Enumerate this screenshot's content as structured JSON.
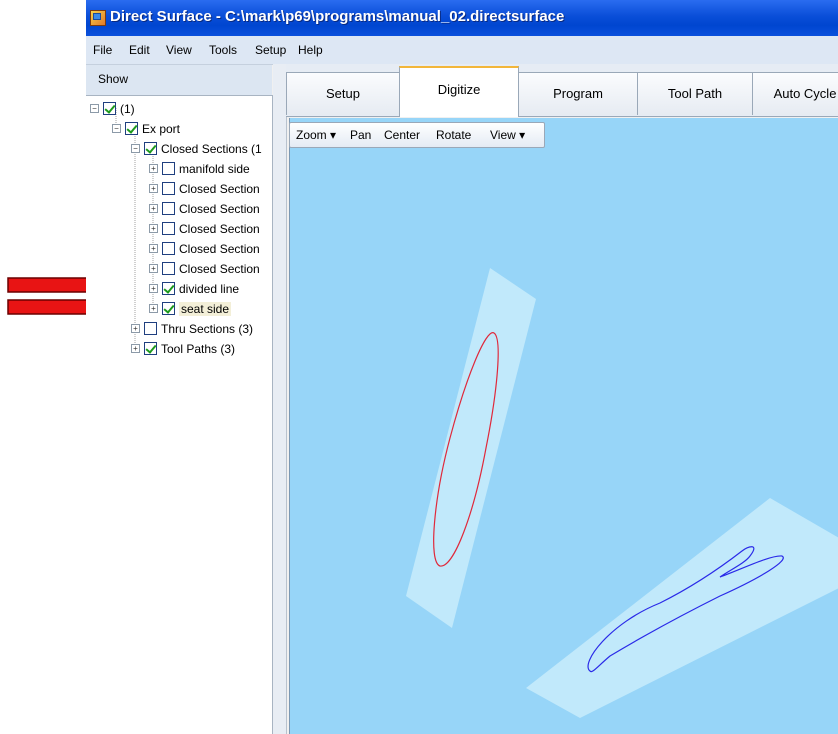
{
  "window": {
    "title": "Direct Surface - C:\\mark\\p69\\programs\\manual_02.directsurface"
  },
  "menu": {
    "items": [
      "File",
      "Edit",
      "View",
      "Tools",
      "Setup",
      "Help"
    ]
  },
  "sidebar": {
    "header": "Show",
    "tree": [
      {
        "label": "(1)",
        "checked": true
      },
      {
        "label": "Ex port",
        "checked": true
      },
      {
        "label": "Closed Sections (1",
        "checked": true
      },
      {
        "label": "manifold side",
        "checked": false
      },
      {
        "label": "Closed Section",
        "checked": false
      },
      {
        "label": "Closed Section",
        "checked": false
      },
      {
        "label": "Closed Section",
        "checked": false
      },
      {
        "label": "Closed Section",
        "checked": false
      },
      {
        "label": "Closed Section",
        "checked": false
      },
      {
        "label": "divided line",
        "checked": true
      },
      {
        "label": "seat side",
        "checked": true
      },
      {
        "label": "Thru Sections (3)",
        "checked": false
      },
      {
        "label": "Tool Paths (3)",
        "checked": true
      }
    ]
  },
  "tabs": [
    "Setup",
    "Digitize",
    "Program",
    "Tool Path",
    "Auto Cycle"
  ],
  "active_tab": "Digitize",
  "view_toolbar": [
    "Zoom ▾",
    "Pan",
    "Center",
    "Rotate",
    "View ▾"
  ],
  "colors": {
    "viewport_bg": "#97d5f8",
    "plane": "#c8ecfb",
    "red_curve": "#e0283a",
    "blue_curve": "#2a2ae8",
    "arrow": "#e81414"
  }
}
